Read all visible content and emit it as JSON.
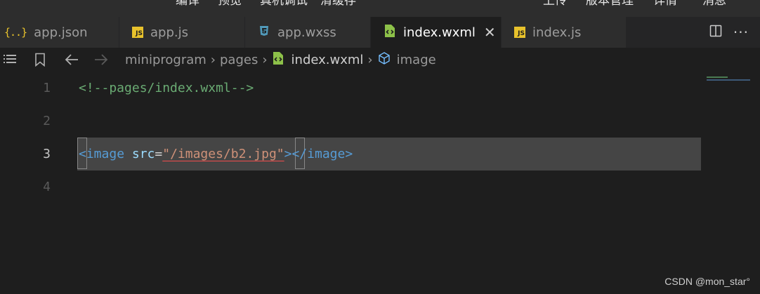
{
  "toolbar": {
    "items": [
      "编译",
      "预览",
      "真机调试",
      "清缓存",
      "上传",
      "版本管理",
      "详情",
      "消息"
    ]
  },
  "tabs": [
    {
      "label": "app.json",
      "icon": "json-file-icon"
    },
    {
      "label": "app.js",
      "icon": "js-file-icon"
    },
    {
      "label": "app.wxss",
      "icon": "css-file-icon"
    },
    {
      "label": "index.wxml",
      "icon": "wxml-file-icon",
      "active": true
    },
    {
      "label": "index.js",
      "icon": "js-file-icon"
    }
  ],
  "breadcrumb": {
    "items": [
      "miniprogram",
      "pages",
      "index.wxml",
      "image"
    ]
  },
  "editor": {
    "lines": [
      {
        "number": "1",
        "text": "<!--pages/index.wxml-->"
      },
      {
        "number": "2",
        "text": ""
      },
      {
        "number": "3",
        "tag_open": "image",
        "attr": "src",
        "value": "\"/images/b2.jpg\"",
        "tag_close": "image"
      },
      {
        "number": "4",
        "text": ""
      }
    ]
  },
  "watermark": "CSDN @mon_star°",
  "colors": {
    "background": "#1e1e1e",
    "tab_bar": "#252526",
    "comment": "#6aab73",
    "tag": "#569cd6",
    "attribute": "#9cdcfe",
    "string": "#ce9178",
    "js_icon": "#e8c22c",
    "css_icon": "#519aba",
    "wxml_icon": "#8dc149"
  }
}
